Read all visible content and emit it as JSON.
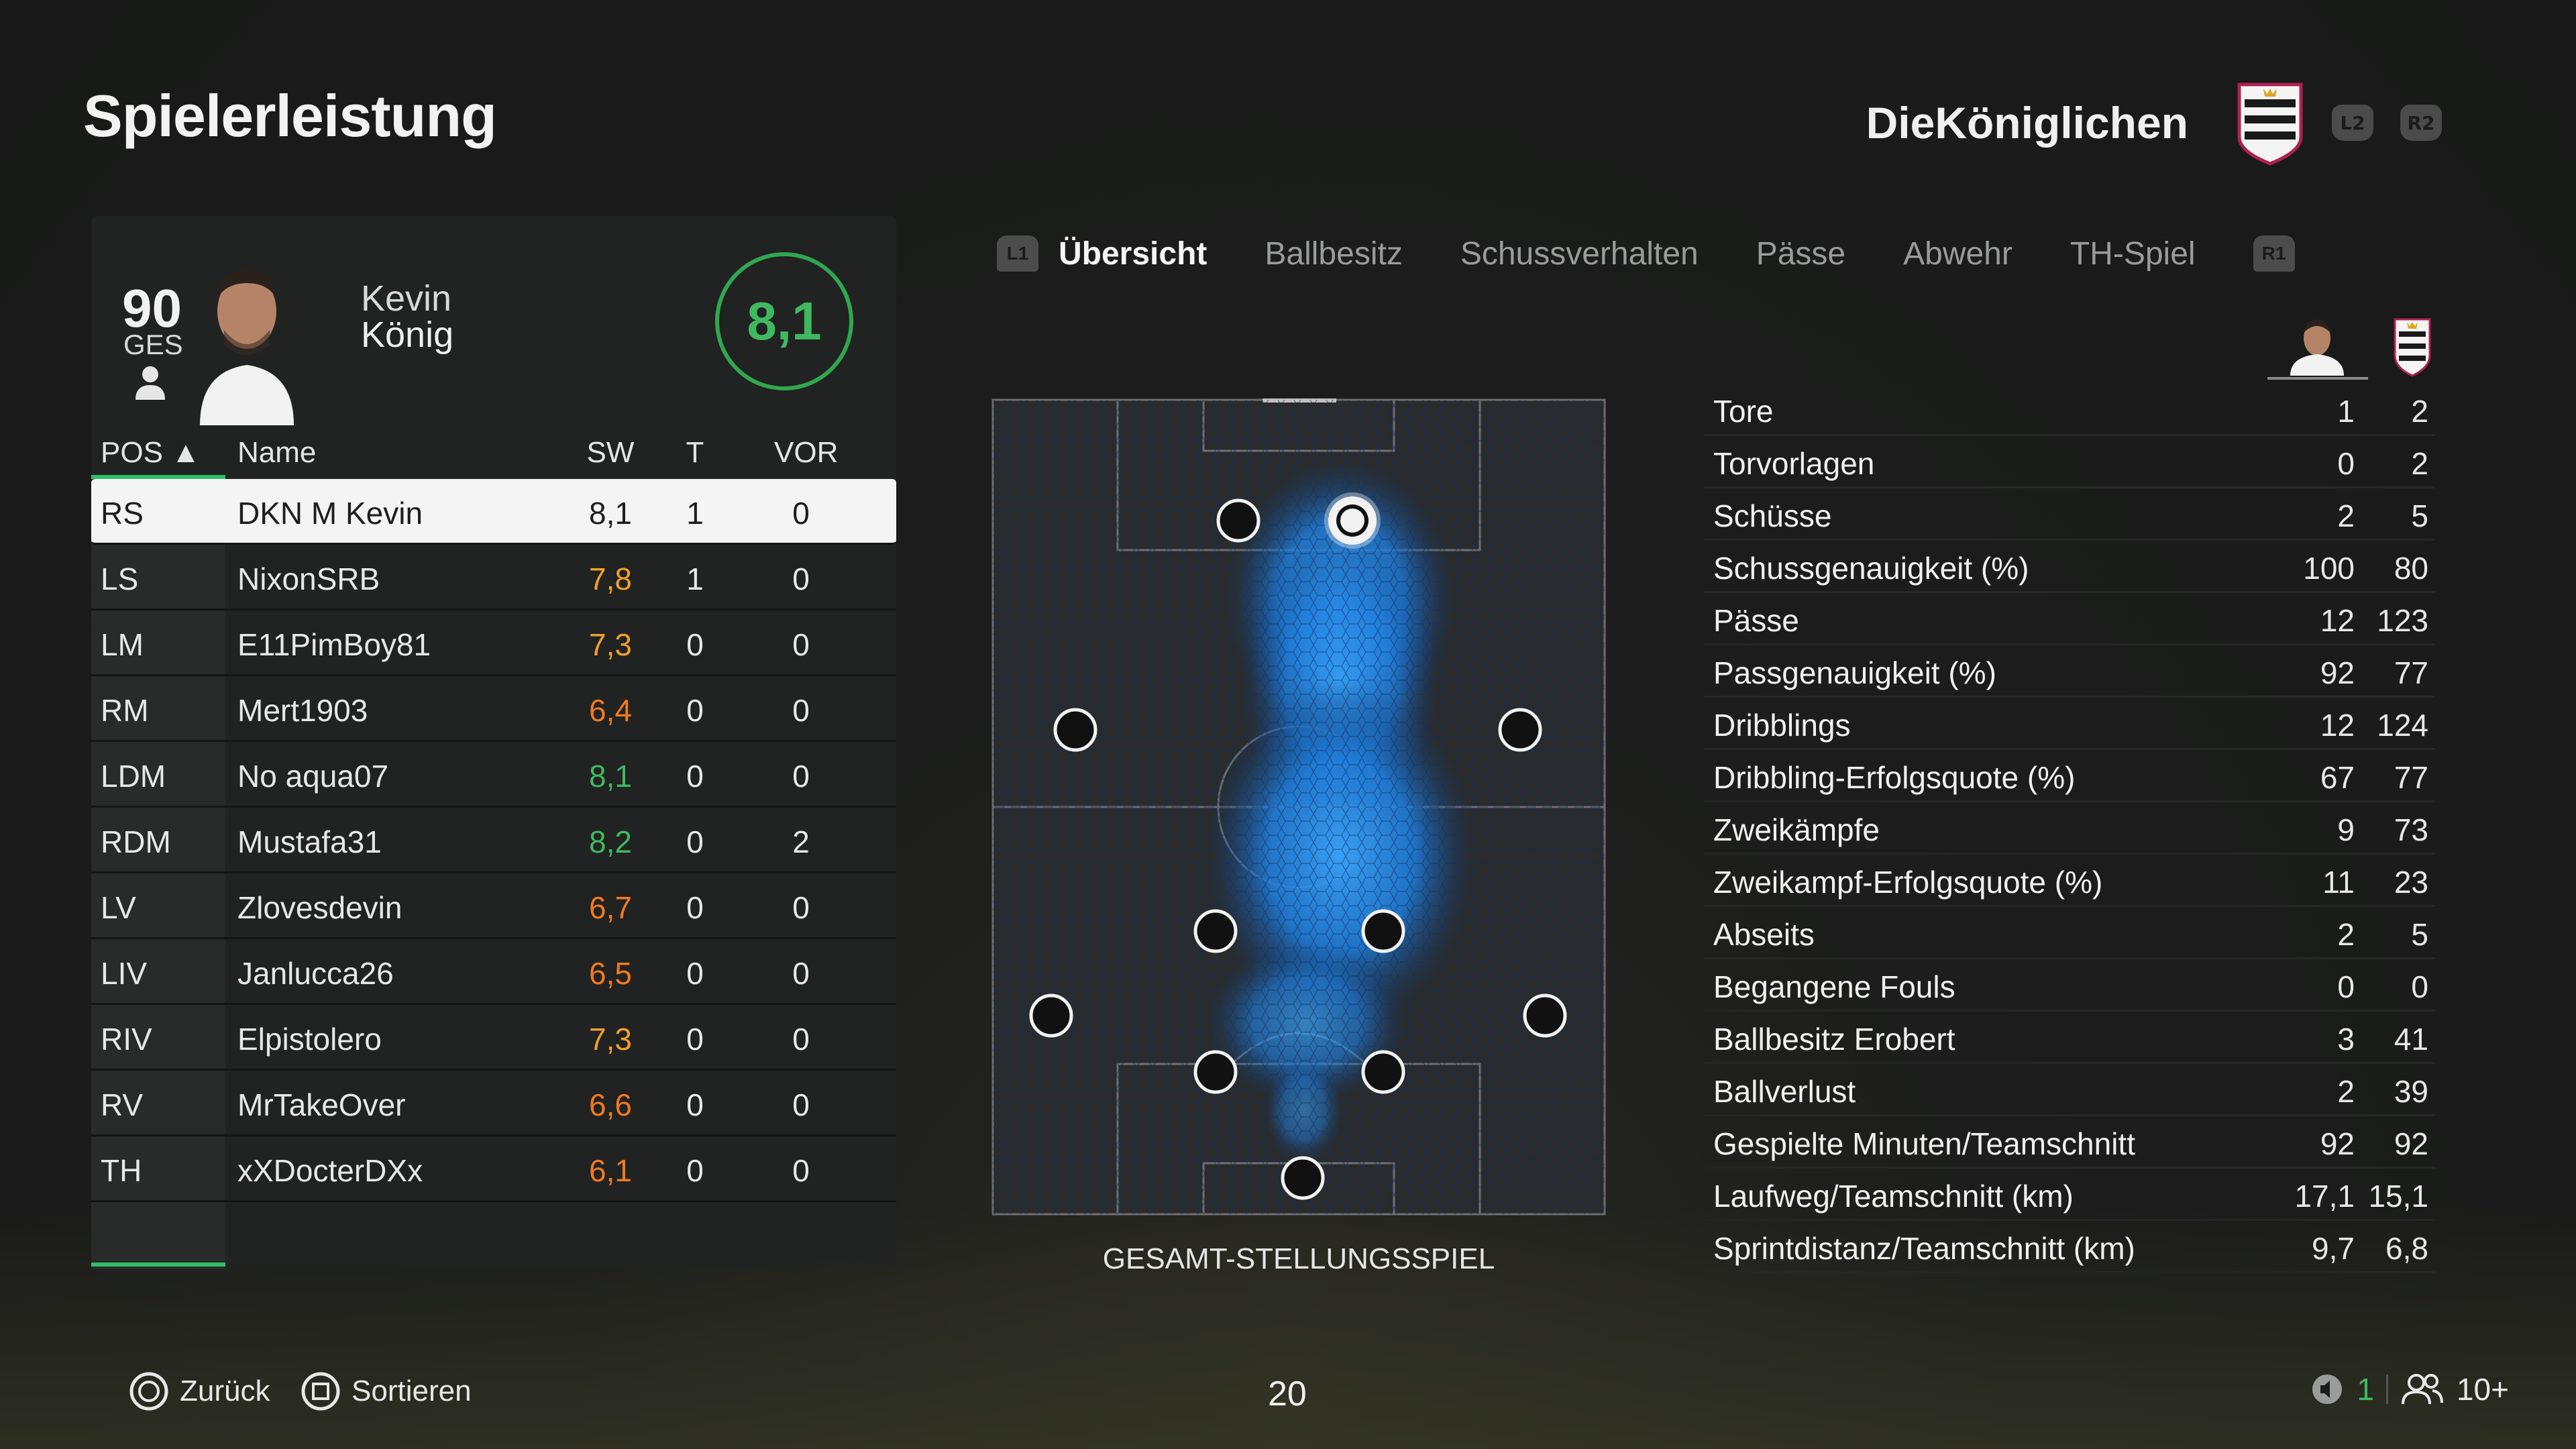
{
  "page": {
    "title": "Spielerleistung"
  },
  "team": {
    "name": "DieKöniglichen",
    "l2": "L2",
    "r2": "R2"
  },
  "player": {
    "overall": "90",
    "overall_label": "GES",
    "first_name": "Kevin",
    "last_name": "König",
    "rating": "8,1"
  },
  "table": {
    "headers": {
      "pos": "POS ▲",
      "name": "Name",
      "sw": "SW",
      "t": "T",
      "vor": "VOR"
    },
    "rows": [
      {
        "pos": "RS",
        "name": "DKN M Kevin",
        "sw": "8,1",
        "t": "1",
        "vor": "0",
        "sw_color": "#1e1e1e"
      },
      {
        "pos": "LS",
        "name": "NixonSRB",
        "sw": "7,8",
        "t": "1",
        "vor": "0",
        "sw_color": "#f0a02a"
      },
      {
        "pos": "LM",
        "name": "E11PimBoy81",
        "sw": "7,3",
        "t": "0",
        "vor": "0",
        "sw_color": "#f0a02a"
      },
      {
        "pos": "RM",
        "name": "Mert1903",
        "sw": "6,4",
        "t": "0",
        "vor": "0",
        "sw_color": "#f07a1f"
      },
      {
        "pos": "LDM",
        "name": "No aqua07",
        "sw": "8,1",
        "t": "0",
        "vor": "0",
        "sw_color": "#3fb85f"
      },
      {
        "pos": "RDM",
        "name": "Mustafa31",
        "sw": "8,2",
        "t": "0",
        "vor": "2",
        "sw_color": "#3fb85f"
      },
      {
        "pos": "LV",
        "name": "Zlovesdevin",
        "sw": "6,7",
        "t": "0",
        "vor": "0",
        "sw_color": "#f07a1f"
      },
      {
        "pos": "LIV",
        "name": "Janlucca26",
        "sw": "6,5",
        "t": "0",
        "vor": "0",
        "sw_color": "#f07a1f"
      },
      {
        "pos": "RIV",
        "name": "Elpistolero",
        "sw": "7,3",
        "t": "0",
        "vor": "0",
        "sw_color": "#f0a02a"
      },
      {
        "pos": "RV",
        "name": "MrTakeOver",
        "sw": "6,6",
        "t": "0",
        "vor": "0",
        "sw_color": "#f07a1f"
      },
      {
        "pos": "TH",
        "name": "xXDocterDXx",
        "sw": "6,1",
        "t": "0",
        "vor": "0",
        "sw_color": "#f07a1f"
      }
    ]
  },
  "tabs": {
    "l1": "L1",
    "r1": "R1",
    "items": [
      "Übersicht",
      "Ballbesitz",
      "Schussverhalten",
      "Pässe",
      "Abwehr",
      "TH-Spiel"
    ]
  },
  "pitch": {
    "label": "GESAMT-STELLUNGSSPIEL"
  },
  "stats": [
    {
      "label": "Tore",
      "me": "1",
      "team": "2"
    },
    {
      "label": "Torvorlagen",
      "me": "0",
      "team": "2"
    },
    {
      "label": "Schüsse",
      "me": "2",
      "team": "5"
    },
    {
      "label": "Schussgenauigkeit (%)",
      "me": "100",
      "team": "80"
    },
    {
      "label": "Pässe",
      "me": "12",
      "team": "123"
    },
    {
      "label": "Passgenauigkeit (%)",
      "me": "92",
      "team": "77"
    },
    {
      "label": "Dribblings",
      "me": "12",
      "team": "124"
    },
    {
      "label": "Dribbling-Erfolgsquote (%)",
      "me": "67",
      "team": "77"
    },
    {
      "label": "Zweikämpfe",
      "me": "9",
      "team": "73"
    },
    {
      "label": "Zweikampf-Erfolgsquote (%)",
      "me": "11",
      "team": "23"
    },
    {
      "label": "Abseits",
      "me": "2",
      "team": "5"
    },
    {
      "label": "Begangene Fouls",
      "me": "0",
      "team": "0"
    },
    {
      "label": "Ballbesitz Erobert",
      "me": "3",
      "team": "41"
    },
    {
      "label": "Ballverlust",
      "me": "2",
      "team": "39"
    },
    {
      "label": "Gespielte Minuten/Teamschnitt",
      "me": "92",
      "team": "92"
    },
    {
      "label": "Laufweg/Teamschnitt (km)",
      "me": "17,1",
      "team": "15,1"
    },
    {
      "label": "Sprintdistanz/Teamschnitt (km)",
      "me": "9,7",
      "team": "6,8"
    }
  ],
  "footer": {
    "back_label": "Zurück",
    "sort_label": "Sortieren",
    "page_number": "20",
    "online_count": "1",
    "players_label": "10+"
  },
  "colors": {
    "accent_green": "#2fbf67",
    "heat_blue": "#2a8ff0"
  }
}
